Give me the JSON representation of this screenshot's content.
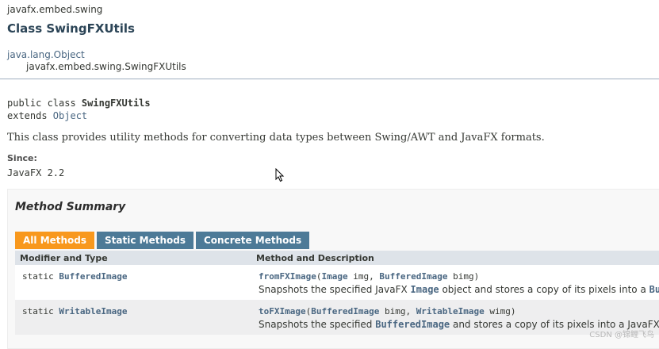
{
  "header": {
    "package": "javafx.embed.swing",
    "class_title": "Class SwingFXUtils",
    "inheritance": [
      "java.lang.Object",
      "javafx.embed.swing.SwingFXUtils"
    ]
  },
  "signature": {
    "line1_prefix": "public class ",
    "line1_name": "SwingFXUtils",
    "line2_prefix": "extends ",
    "line2_link": "Object"
  },
  "description": "This class provides utility methods for converting data types between Swing/AWT and JavaFX formats.",
  "since": {
    "label": "Since:",
    "value": "JavaFX 2.2"
  },
  "method_summary": {
    "title": "Method Summary",
    "tabs": [
      "All Methods",
      "Static Methods",
      "Concrete Methods"
    ],
    "columns": [
      "Modifier and Type",
      "Method and Description"
    ],
    "rows": [
      {
        "modifier": "static ",
        "type": "BufferedImage",
        "method": "fromFXImage",
        "p1_type": "Image",
        "p1_name": " img, ",
        "p2_type": "BufferedImage",
        "p2_name": " bimg)",
        "desc_a": "Snapshots the specified JavaFX ",
        "desc_b": "Image",
        "desc_c": " object and stores a copy of its pixels into a ",
        "desc_d": "Buff"
      },
      {
        "modifier": "static ",
        "type": "WritableImage",
        "method": "toFXImage",
        "p1_type": "BufferedImage",
        "p1_name": " bimg, ",
        "p2_type": "WritableImage",
        "p2_name": " wimg)",
        "desc_a": "Snapshots the specified ",
        "desc_b": "BufferedImage",
        "desc_c": " and stores a copy of its pixels into a JavaFX ",
        "desc_d": "Im"
      }
    ]
  },
  "watermark": "CSDN @锦鲤飞鸟",
  "colors": {
    "active_tab": "#f8981d",
    "inactive_tab": "#4d7a97",
    "title": "#2c4557",
    "link": "#4a6782"
  }
}
